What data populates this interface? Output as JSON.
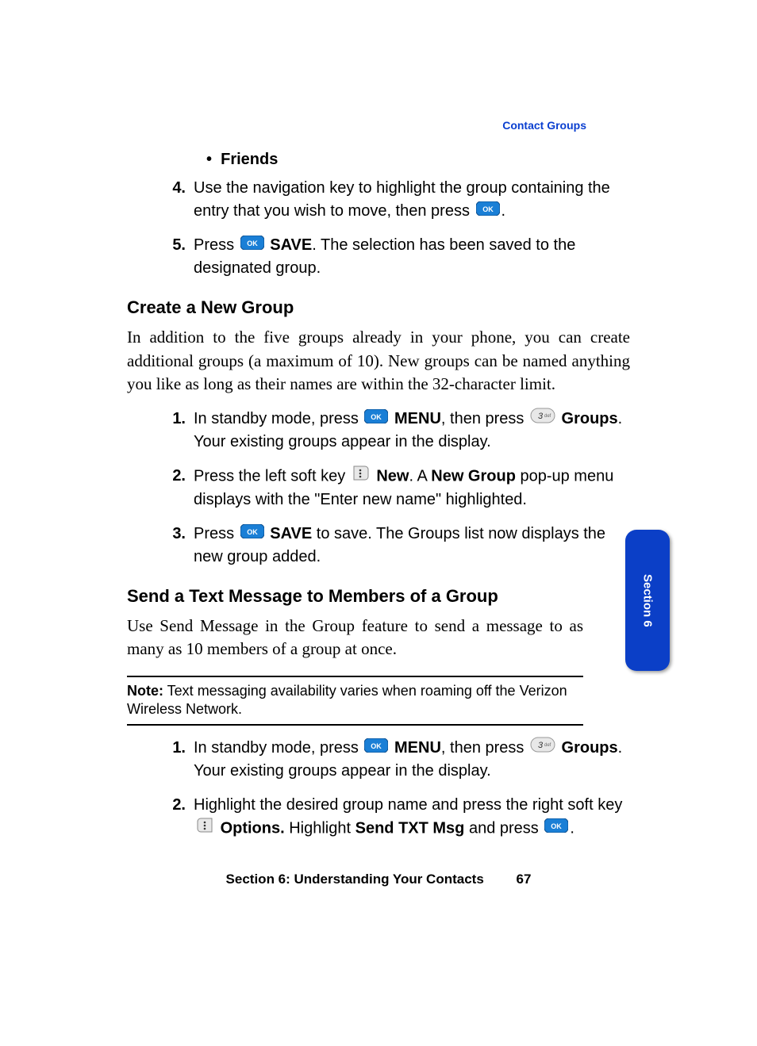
{
  "header_label": "Contact Groups",
  "bullet_friends": "Friends",
  "step4_num": "4.",
  "step4a": "Use the navigation key to highlight the group containing the entry that you wish to move, then press ",
  "step4b": ".",
  "step5_num": "5.",
  "step5a": "Press ",
  "step5_save": "SAVE",
  "step5b": ". The selection has been saved to the designated group.",
  "h_create": "Create a New Group",
  "para_create": "In addition to the five groups already in your phone, you can create additional groups (a maximum of 10). New groups can be named anything you like as long as their names are within the 32-character limit.",
  "c1_num": "1.",
  "c1a": "In standby mode, press ",
  "c1_menu": "MENU",
  "c1b": ", then press ",
  "c1_groups": "Groups",
  "c1c": ". Your existing groups appear in the display.",
  "c2_num": "2.",
  "c2a": "Press the left soft key ",
  "c2_new": "New",
  "c2b": ". A ",
  "c2_newgroup": "New Group",
  "c2c": " pop-up menu displays with the \"Enter new name\" highlighted.",
  "c3_num": "3.",
  "c3a": "Press ",
  "c3_save": "SAVE",
  "c3b": " to save. The Groups list now displays the new group added.",
  "h_send": "Send a Text Message to Members of a Group",
  "para_send": "Use Send Message in the Group feature to send a message to as many as 10 members of a group at once.",
  "note_label": "Note:",
  "note_text": " Text messaging availability varies when roaming off the Verizon Wireless Network.",
  "s1_num": "1.",
  "s1a": "In standby mode, press ",
  "s1_menu": "MENU",
  "s1b": ", then press ",
  "s1_groups": "Groups",
  "s1c": ". Your existing groups appear in the display.",
  "s2_num": "2.",
  "s2a": "Highlight the desired group name and press the right soft key ",
  "s2_options": "Options.",
  "s2b": " Highlight ",
  "s2_sendtxt": "Send TXT Msg",
  "s2c": " and press ",
  "s2d": ".",
  "footer_section": "Section 6: Understanding Your Contacts",
  "footer_page": "67",
  "tab_label": "Section 6"
}
